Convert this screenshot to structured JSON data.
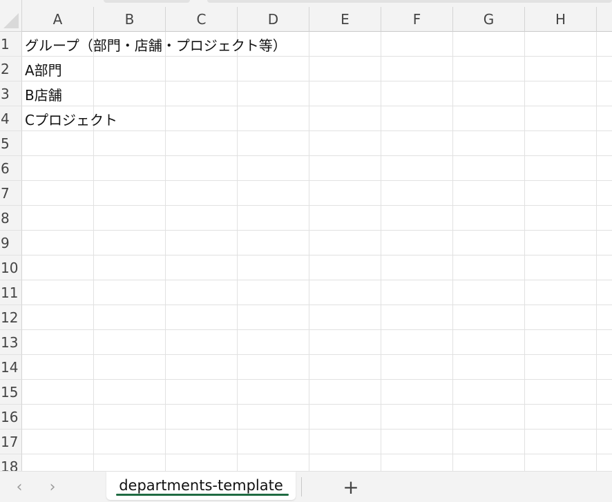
{
  "columns": [
    "A",
    "B",
    "C",
    "D",
    "E",
    "F",
    "G",
    "H"
  ],
  "rows": [
    "1",
    "2",
    "3",
    "4",
    "5",
    "6",
    "7",
    "8",
    "9",
    "10",
    "11",
    "12",
    "13",
    "14",
    "15",
    "16",
    "17",
    "18"
  ],
  "cells": {
    "A1": "グループ（部門・店舗・プロジェクト等）",
    "A2": "A部門",
    "A3": "B店舗",
    "A4": "Cプロジェクト"
  },
  "tabbar": {
    "prev_icon": "chevron-left-icon",
    "next_icon": "chevron-right-icon",
    "active_sheet": "departments-template",
    "add_icon": "plus-icon",
    "accent_color": "#1e6b42"
  }
}
